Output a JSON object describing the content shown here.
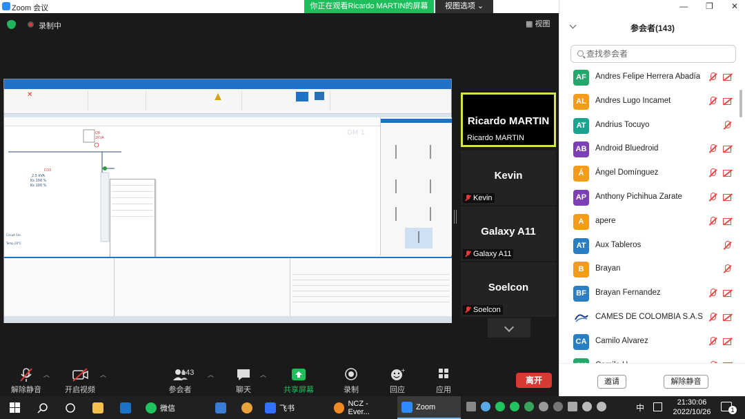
{
  "app": {
    "title": "Zoom 会议",
    "viewing_banner": "你正在观看Ricardo MARTIN的屏幕",
    "view_options": "视图选项",
    "recording_label": "录制中",
    "view_button": "视图"
  },
  "gallery": {
    "tiles": [
      {
        "name": "Ricardo MARTIN",
        "label": "Ricardo MARTIN",
        "active": true
      },
      {
        "name": "Kevin",
        "label": "Kevin"
      },
      {
        "name": "Galaxy A11",
        "label": "Galaxy A11"
      },
      {
        "name": "Soelcon",
        "label": "Soelcon"
      }
    ]
  },
  "toolbar": {
    "unmute": "解除静音",
    "start_video": "开启视频",
    "participants": "参会者",
    "participants_count": "143",
    "chat": "聊天",
    "share": "共享屏幕",
    "record": "录制",
    "reactions": "回应",
    "apps": "应用",
    "leave": "离开"
  },
  "panel": {
    "title": "参会者(143)",
    "search_placeholder": "查找参会者",
    "invite": "邀请",
    "unmute_all": "解除静音",
    "participants": [
      {
        "initials": "AF",
        "name": "Andres Felipe Herrera Abadía",
        "color": "#25a66a",
        "video_off": true
      },
      {
        "initials": "AL",
        "name": "Andres Lugo Incamet",
        "color": "#f39c1b",
        "video_off": true
      },
      {
        "initials": "AT",
        "name": "Andrius Tocuyo",
        "color": "#1aa48f",
        "video_off": false
      },
      {
        "initials": "AB",
        "name": "Android Bluedroid",
        "color": "#7d3fb6",
        "video_off": true
      },
      {
        "initials": "Á",
        "name": "Ángel Domínguez",
        "color": "#f39c1b",
        "video_off": true
      },
      {
        "initials": "AP",
        "name": "Anthony Pichihua Zarate",
        "color": "#7d3fb6",
        "video_off": true
      },
      {
        "initials": "A",
        "name": "apere",
        "color": "#f39c1b",
        "video_off": true
      },
      {
        "initials": "AT",
        "name": "Aux Tableros",
        "color": "#2a7fc4",
        "video_off": false
      },
      {
        "initials": "B",
        "name": "Brayan",
        "color": "#f39c1b",
        "video_off": false
      },
      {
        "initials": "BF",
        "name": "Brayan Fernandez",
        "color": "#2a7fc4",
        "video_off": true
      },
      {
        "initials": "",
        "name": "CAMES DE COLOMBIA S.A.S",
        "color": "#ffffff",
        "video_off": true,
        "logo": true
      },
      {
        "initials": "CA",
        "name": "Camilo Alvarez",
        "color": "#2a7fc4",
        "video_off": true
      },
      {
        "initials": "CH",
        "name": "Camilo H",
        "color": "#25a66a",
        "video_off": true
      }
    ]
  },
  "taskbar": {
    "wechat": "微信",
    "feishu": "飞书",
    "ncz": "NCZ - Ever...",
    "zoom": "Zoom",
    "ime": "中",
    "time": "21:30:06",
    "date": "2022/10/26",
    "notif_count": "1"
  }
}
